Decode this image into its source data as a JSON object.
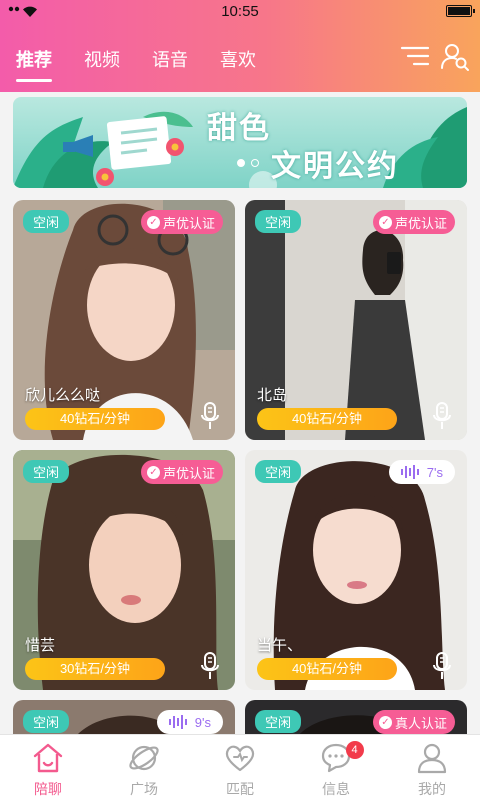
{
  "status_bar": {
    "time": "10:55",
    "battery_level": 1.0
  },
  "header": {
    "tabs": [
      {
        "label": "推荐",
        "active": true
      },
      {
        "label": "视频",
        "active": false
      },
      {
        "label": "语音",
        "active": false
      },
      {
        "label": "喜欢",
        "active": false
      }
    ],
    "icons": [
      "menu-icon",
      "user-search-icon"
    ]
  },
  "banner": {
    "line1": "甜色",
    "line2": "文明公约",
    "current_slide": 1,
    "slide_count": 2
  },
  "cards": [
    {
      "status": "空闲",
      "badge_type": "cert",
      "badge": "声优认证",
      "name": "欣儿么么哒",
      "price": "40钻石/分钟"
    },
    {
      "status": "空闲",
      "badge_type": "cert",
      "badge": "声优认证",
      "name": "北岛",
      "price": "40钻石/分钟"
    },
    {
      "status": "空闲",
      "badge_type": "cert",
      "badge": "声优认证",
      "name": "惜芸",
      "price": "30钻石/分钟"
    },
    {
      "status": "空闲",
      "badge_type": "voice",
      "badge": "7's",
      "name": "当午、",
      "price": "40钻石/分钟"
    },
    {
      "status": "空闲",
      "badge_type": "voice",
      "badge": "9's",
      "name": "",
      "price": ""
    },
    {
      "status": "空闲",
      "badge_type": "cert",
      "badge": "真人认证",
      "name": "",
      "price": ""
    }
  ],
  "bottom_nav": [
    {
      "label": "陪聊",
      "icon": "home-icon",
      "active": true
    },
    {
      "label": "广场",
      "icon": "planet-icon",
      "active": false
    },
    {
      "label": "匹配",
      "icon": "hearts-icon",
      "active": false
    },
    {
      "label": "信息",
      "icon": "chat-bubble-icon",
      "active": false,
      "badge": "4"
    },
    {
      "label": "我的",
      "icon": "profile-icon",
      "active": false
    }
  ],
  "colors": {
    "accent_pink": "#f35a8e",
    "idle_green": "#3ec8b5",
    "price_yellow": "#fcc417",
    "voice_purple": "#9a6cf0"
  }
}
